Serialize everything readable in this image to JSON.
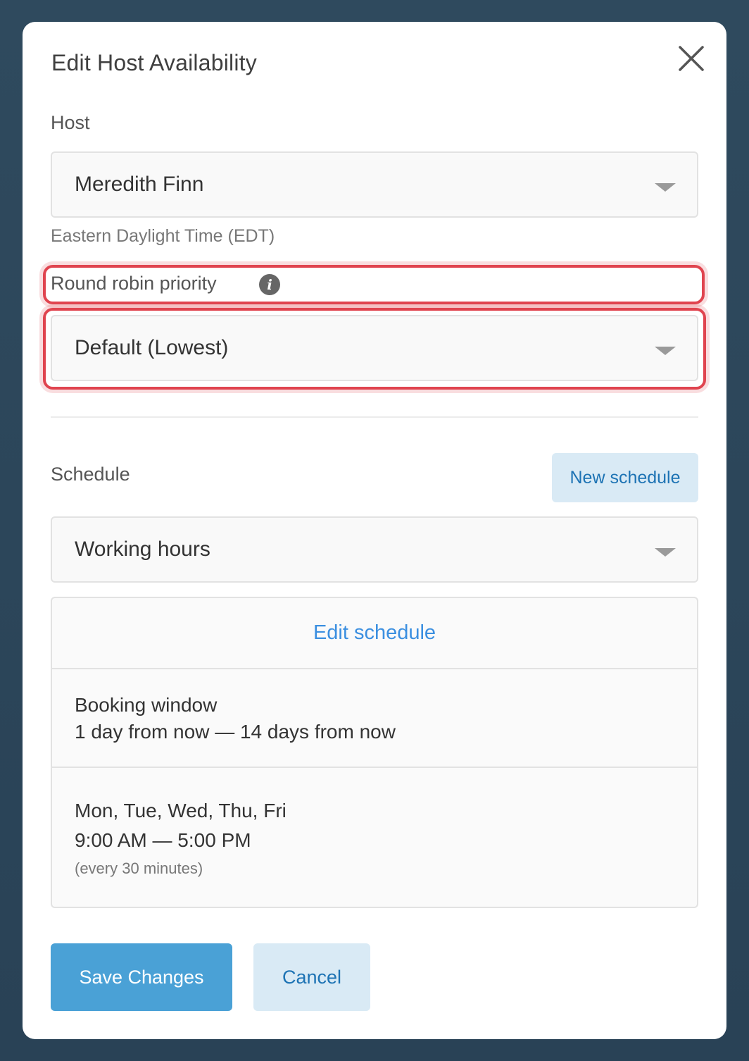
{
  "dialog": {
    "title": "Edit Host Availability",
    "close_icon": "close-icon"
  },
  "host": {
    "label": "Host",
    "selected": "Meredith Finn",
    "timezone_hint": "Eastern Daylight Time (EDT)"
  },
  "priority": {
    "label": "Round robin priority",
    "info_icon": "info-icon",
    "info_glyph": "i",
    "selected": "Default (Lowest)",
    "highlight_color": "#e0444f"
  },
  "schedule": {
    "label": "Schedule",
    "new_button": "New schedule",
    "selected": "Working hours",
    "edit_link": "Edit schedule",
    "booking_window_label": "Booking window",
    "booking_window_value": "1 day from now — 14 days from now",
    "days": "Mon, Tue, Wed, Thu, Fri",
    "hours": "9:00 AM — 5:00 PM",
    "interval": "(every 30 minutes)"
  },
  "footer": {
    "save_label": "Save Changes",
    "cancel_label": "Cancel"
  },
  "colors": {
    "primary": "#4aa1d6",
    "secondary_bg": "#d9eaf5",
    "link": "#3b8fe0",
    "backdrop": "#2f4a5e"
  }
}
